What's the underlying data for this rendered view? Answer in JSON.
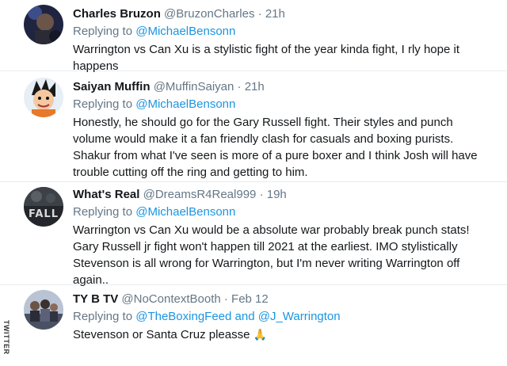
{
  "tweets": [
    {
      "name": "Charles Bruzon",
      "handle": "@BruzonCharles",
      "dot": "·",
      "time": "21h",
      "replying_prefix": "Replying to",
      "mentions": [
        "@MichaelBensonn"
      ],
      "mention_joiner": "",
      "text": "Warrington vs Can Xu is a stylistic fight of the year kinda fight, I rly hope it happens",
      "avatar": "dark-portrait-avatar"
    },
    {
      "name": "Saiyan Muffin",
      "handle": "@MuffinSaiyan",
      "dot": "·",
      "time": "21h",
      "replying_prefix": "Replying to",
      "mentions": [
        "@MichaelBensonn"
      ],
      "mention_joiner": "",
      "text": "Honestly, he should go for the Gary Russell fight. Their styles and punch volume would make it a fan friendly clash for casuals and boxing purists. Shakur from what I've seen is more of a pure boxer and I think Josh will have trouble cutting off the ring and getting to him.",
      "avatar": "cartoon-character-avatar"
    },
    {
      "name": "What's Real",
      "handle": "@DreamsR4Real999",
      "dot": "·",
      "time": "19h",
      "replying_prefix": "Replying to",
      "mentions": [
        "@MichaelBensonn"
      ],
      "mention_joiner": "",
      "text": "Warrington vs Can Xu would be a absolute war probably break punch stats! Gary Russell jr fight won't happen till 2021 at the earliest. IMO stylistically Stevenson is all wrong for Warrington, but I'm never writing Warrington off again..",
      "avatar": "fall-poster-avatar",
      "avatar_text": "FALL"
    },
    {
      "name": "TY B TV",
      "handle": "@NoContextBooth",
      "dot": "·",
      "time": "Feb 12",
      "replying_prefix": "Replying to",
      "mentions": [
        "@TheBoxingFeed",
        "@J_Warrington"
      ],
      "mention_joiner": "and",
      "text": "Stevenson or Santa Cruz pleasse",
      "emoji": "🙏",
      "avatar": "group-photo-avatar"
    }
  ],
  "watermark": "TWITTER",
  "colors": {
    "name": "#14171a",
    "secondary": "#657786",
    "mention": "#1b95e0",
    "divider": "#e6ecf0"
  }
}
